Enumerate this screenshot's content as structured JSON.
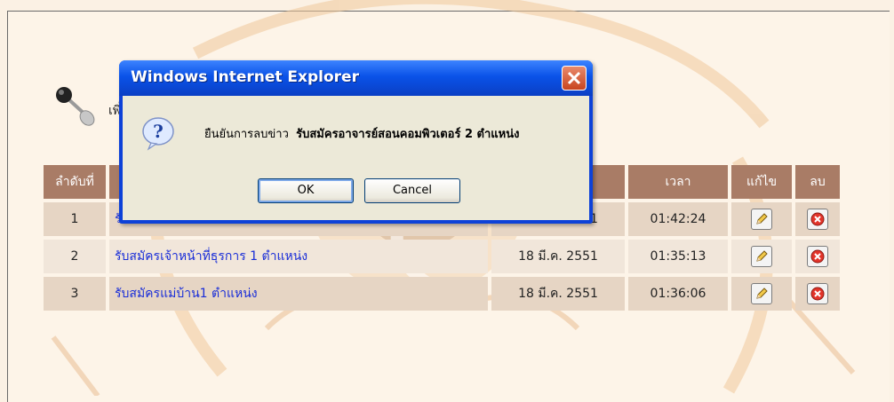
{
  "page": {
    "heading": "เพิ่มข่าว"
  },
  "table": {
    "headers": {
      "no": "ลำดับที่",
      "title": "",
      "date": "",
      "time": "เวลา",
      "edit": "แก้ไข",
      "delete": "ลบ"
    },
    "rows": [
      {
        "no": "1",
        "title": "รับสมัครอาจารย์สอนคอมพิวเตอร์ 2 ตำแหน่ง",
        "date": "18 มี.ค. 2551",
        "time": "01:42:24"
      },
      {
        "no": "2",
        "title": "รับสมัครเจ้าหน้าที่ธุรการ 1 ตำแหน่ง",
        "date": "18 มี.ค. 2551",
        "time": "01:35:13"
      },
      {
        "no": "3",
        "title": "รับสมัครแม่บ้าน1 ตำแหน่ง",
        "date": "18 มี.ค. 2551",
        "time": "01:36:06"
      }
    ]
  },
  "dialog": {
    "title": "Windows Internet Explorer",
    "message_prefix": "ยืนยันการลบข่าว",
    "message_subject": "รับสมัครอาจารย์สอนคอมพิวเตอร์ 2 ตำแหน่ง",
    "ok_label": "OK",
    "cancel_label": "Cancel"
  },
  "colors": {
    "header_bg": "#a97c66",
    "row_bg": "#e6d5c4",
    "link": "#1a2ed8",
    "dialog_title": "#0a52e8"
  },
  "icons": [
    "pin-icon",
    "pencil-icon",
    "delete-icon",
    "question-icon",
    "close-icon"
  ]
}
